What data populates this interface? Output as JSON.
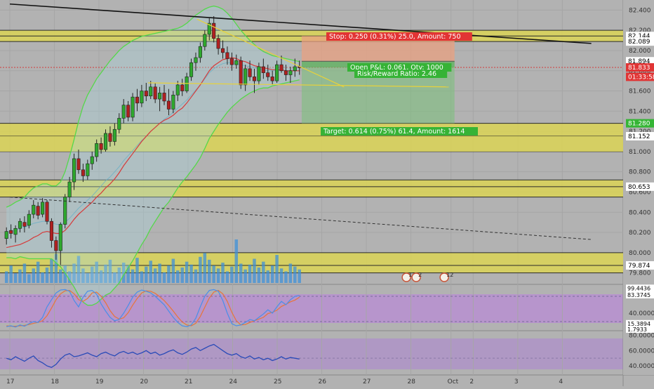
{
  "colors": {
    "background": "#b2b2b2",
    "zone_fill": "#d8d25a",
    "zone_line": "#2a2a2a",
    "stop_fill": "#e8a080",
    "target_fill": "#7ec07e",
    "up_candle": "#2ea82e",
    "down_candle": "#b02020",
    "bollinger": "#55d84a",
    "ema": "#d63a3a",
    "stoch_k": "#4a8ee8",
    "stoch_d": "#e8743a",
    "rsi": "#2a4bb8",
    "volume": "#3d90d8",
    "stoch_panel": "#b78fd0",
    "rsi_panel": "#ad8fca"
  },
  "price_axis": {
    "ticks": [
      "82.400",
      "82.200",
      "82.000",
      "81.800",
      "81.600",
      "81.400",
      "81.200",
      "81.000",
      "80.800",
      "80.600",
      "80.400",
      "80.200",
      "80.000",
      "79.800"
    ],
    "badges": [
      {
        "label": "82.144",
        "price": 82.144,
        "bg": "#ffffff",
        "fg": "#000000"
      },
      {
        "label": "82.089",
        "price": 82.089,
        "bg": "#ffffff",
        "fg": "#000000"
      },
      {
        "label": "81.894",
        "price": 81.894,
        "bg": "#ffffff",
        "fg": "#000000"
      },
      {
        "label": "81.833",
        "price": 81.833,
        "bg": "#e03535",
        "fg": "#ffffff"
      },
      {
        "label": "01:33:58",
        "price": 81.74,
        "bg": "#e03535",
        "fg": "#ffffff"
      },
      {
        "label": "81.280",
        "price": 81.28,
        "bg": "#35b535",
        "fg": "#ffffff"
      },
      {
        "label": "81.152",
        "price": 81.152,
        "bg": "#ffffff",
        "fg": "#000000"
      },
      {
        "label": "80.653",
        "price": 80.653,
        "bg": "#ffffff",
        "fg": "#000000"
      },
      {
        "label": "79.874",
        "price": 79.874,
        "bg": "#ffffff",
        "fg": "#000000"
      }
    ]
  },
  "stoch_axis": {
    "ticks": [
      "40.0000"
    ],
    "badges": [
      {
        "label": "99.4436",
        "value": 99.44,
        "bg": "#ffffff",
        "fg": "#000000"
      },
      {
        "label": "83.3745",
        "value": 83.37,
        "bg": "#ffffff",
        "fg": "#000000"
      },
      {
        "label": "15.3894",
        "value": 15.39,
        "bg": "#ffffff",
        "fg": "#000000"
      },
      {
        "label": "1.7933",
        "value": 1.79,
        "bg": "#ffffff",
        "fg": "#000000"
      }
    ]
  },
  "rsi_axis": {
    "ticks": [
      "80.0000",
      "60.0000",
      "40.0000"
    ]
  },
  "time_axis": {
    "labels": [
      {
        "label": "17",
        "t": 0
      },
      {
        "label": "18",
        "t": 1
      },
      {
        "label": "19",
        "t": 2
      },
      {
        "label": "20",
        "t": 3
      },
      {
        "label": "21",
        "t": 4
      },
      {
        "label": "24",
        "t": 5
      },
      {
        "label": "25",
        "t": 6
      },
      {
        "label": "26",
        "t": 7
      },
      {
        "label": "27",
        "t": 8
      },
      {
        "label": "28",
        "t": 9
      },
      {
        "label": "Oct",
        "t": 9.9
      },
      {
        "label": "2",
        "t": 10.4
      },
      {
        "label": "3",
        "t": 11.4
      },
      {
        "label": "4",
        "t": 12.4
      }
    ]
  },
  "annotations": {
    "stop": "Stop: 0.250 (0.31%) 25.0, Amount: 750",
    "open_pl": "Open P&L: 0.061, Qty: 1000",
    "risk_reward": "Risk/Reward Ratio: 2.46",
    "target": "Target: 0.614 (0.75%) 61.4, Amount: 1614"
  },
  "events": [
    {
      "label": "123",
      "t": 8.9
    },
    {
      "label": "2",
      "t": 9.12
    },
    {
      "label": "12",
      "t": 9.75
    }
  ],
  "chart_data": {
    "type": "candlestick",
    "instrument_hint": "price (value axis 79.80–82.40)",
    "ylim": [
      79.7,
      82.5
    ],
    "x_unit": "trading day index (17=0, 18=1, 19=2, 20=3, 21=4, 24=5, 25=6)",
    "zones": [
      {
        "low": 82.089,
        "high": 82.144,
        "upper_edge": 82.2
      },
      {
        "low": 81.28,
        "high": 81.152,
        "extra_line": 81.0
      },
      {
        "low": 80.653,
        "high": 80.55,
        "upper_edge": 80.72
      },
      {
        "low": 79.874,
        "high": 79.8,
        "upper_edge": 80.0
      }
    ],
    "position": {
      "type": "long",
      "start_t": 6.55,
      "end_t": 9.98,
      "entry": 81.894,
      "stop": 82.144,
      "target": 81.28,
      "current": 81.833
    },
    "trendlines": [
      {
        "style": "solid",
        "t1": 0,
        "p1": 82.46,
        "t2": 13.05,
        "p2": 82.07
      },
      {
        "style": "dashed",
        "t1": 0,
        "p1": 80.55,
        "t2": 13.05,
        "p2": 80.13
      },
      {
        "style": "solid-yellow",
        "t1": 4.2,
        "p1": 82.31,
        "t2": 7.5,
        "p2": 81.64
      },
      {
        "style": "flat-yellow",
        "t1": 3.1,
        "p1": 81.68,
        "t2": 9.85,
        "p2": 81.64
      }
    ],
    "candles_ohlc": [
      [
        80.14,
        80.25,
        80.08,
        80.21
      ],
      [
        80.22,
        80.28,
        80.14,
        80.19
      ],
      [
        80.18,
        80.27,
        80.1,
        80.24
      ],
      [
        80.24,
        80.34,
        80.2,
        80.31
      ],
      [
        80.3,
        80.36,
        80.2,
        80.26
      ],
      [
        80.27,
        80.42,
        80.24,
        80.38
      ],
      [
        80.38,
        80.52,
        80.34,
        80.47
      ],
      [
        80.46,
        80.5,
        80.33,
        80.37
      ],
      [
        80.38,
        80.54,
        80.35,
        80.5
      ],
      [
        80.5,
        80.52,
        80.28,
        80.31
      ],
      [
        80.31,
        80.34,
        80.05,
        80.12
      ],
      [
        80.12,
        80.16,
        79.93,
        80.02
      ],
      [
        80.02,
        80.3,
        79.88,
        80.28
      ],
      [
        80.28,
        80.58,
        80.24,
        80.55
      ],
      [
        80.55,
        80.75,
        80.5,
        80.7
      ],
      [
        80.7,
        80.98,
        80.62,
        80.93
      ],
      [
        80.93,
        81.02,
        80.78,
        80.82
      ],
      [
        80.82,
        80.88,
        80.7,
        80.76
      ],
      [
        80.76,
        80.92,
        80.72,
        80.88
      ],
      [
        80.88,
        81.0,
        80.82,
        80.95
      ],
      [
        80.95,
        81.12,
        80.9,
        81.08
      ],
      [
        81.08,
        81.14,
        80.98,
        81.02
      ],
      [
        81.02,
        81.22,
        81.0,
        81.18
      ],
      [
        81.18,
        81.25,
        81.05,
        81.1
      ],
      [
        81.1,
        81.28,
        81.06,
        81.22
      ],
      [
        81.22,
        81.38,
        81.18,
        81.33
      ],
      [
        81.33,
        81.52,
        81.28,
        81.46
      ],
      [
        81.46,
        81.5,
        81.3,
        81.34
      ],
      [
        81.34,
        81.58,
        81.3,
        81.54
      ],
      [
        81.54,
        81.62,
        81.4,
        81.48
      ],
      [
        81.48,
        81.66,
        81.44,
        81.6
      ],
      [
        81.6,
        81.68,
        81.5,
        81.55
      ],
      [
        81.55,
        81.7,
        81.52,
        81.64
      ],
      [
        81.64,
        81.68,
        81.48,
        81.52
      ],
      [
        81.52,
        81.64,
        81.4,
        81.58
      ],
      [
        81.58,
        81.66,
        81.46,
        81.5
      ],
      [
        81.5,
        81.62,
        81.36,
        81.42
      ],
      [
        81.42,
        81.6,
        81.38,
        81.56
      ],
      [
        81.56,
        81.7,
        81.5,
        81.66
      ],
      [
        81.66,
        81.72,
        81.55,
        81.6
      ],
      [
        81.6,
        81.78,
        81.58,
        81.74
      ],
      [
        81.74,
        81.92,
        81.7,
        81.88
      ],
      [
        81.88,
        81.98,
        81.8,
        81.93
      ],
      [
        81.93,
        82.08,
        81.88,
        82.04
      ],
      [
        82.04,
        82.2,
        82.0,
        82.16
      ],
      [
        82.16,
        82.32,
        82.1,
        82.27
      ],
      [
        82.27,
        82.34,
        82.08,
        82.12
      ],
      [
        82.12,
        82.16,
        81.96,
        82.02
      ],
      [
        82.02,
        82.1,
        81.92,
        81.98
      ],
      [
        81.98,
        82.04,
        81.86,
        81.92
      ],
      [
        81.92,
        81.98,
        81.8,
        81.86
      ],
      [
        81.86,
        81.96,
        81.82,
        81.9
      ],
      [
        81.9,
        81.94,
        81.62,
        81.66
      ],
      [
        81.66,
        81.86,
        81.6,
        81.82
      ],
      [
        81.82,
        81.9,
        81.7,
        81.74
      ],
      [
        81.74,
        81.82,
        81.58,
        81.7
      ],
      [
        81.7,
        81.88,
        81.66,
        81.84
      ],
      [
        81.84,
        81.92,
        81.72,
        81.78
      ],
      [
        81.78,
        81.86,
        81.7,
        81.74
      ],
      [
        81.74,
        81.8,
        81.66,
        81.7
      ],
      [
        81.7,
        81.9,
        81.68,
        81.86
      ],
      [
        81.86,
        81.95,
        81.78,
        81.8
      ],
      [
        81.8,
        81.86,
        81.7,
        81.76
      ],
      [
        81.76,
        81.84,
        81.68,
        81.8
      ],
      [
        81.8,
        81.92,
        81.74,
        81.84
      ],
      [
        81.84,
        81.9,
        81.76,
        81.83
      ]
    ],
    "bollinger": {
      "upper": [
        80.45,
        80.47,
        80.5,
        80.52,
        80.55,
        80.6,
        80.64,
        80.66,
        80.68,
        80.68,
        80.66,
        80.66,
        80.7,
        80.8,
        80.95,
        81.12,
        81.3,
        81.45,
        81.56,
        81.64,
        81.72,
        81.78,
        81.84,
        81.9,
        81.95,
        82.0,
        82.04,
        82.07,
        82.1,
        82.12,
        82.14,
        82.15,
        82.16,
        82.17,
        82.18,
        82.19,
        82.2,
        82.21,
        82.22,
        82.24,
        82.27,
        82.31,
        82.35,
        82.38,
        82.41,
        82.43,
        82.44,
        82.43,
        82.41,
        82.37,
        82.32,
        82.26,
        82.2,
        82.15,
        82.1,
        82.06,
        82.02,
        81.99,
        81.97,
        81.95,
        81.94,
        81.93,
        81.92,
        81.91,
        81.9,
        81.89
      ],
      "middle": [
        80.2,
        80.21,
        80.22,
        80.24,
        80.25,
        80.27,
        80.29,
        80.3,
        80.31,
        80.31,
        80.3,
        80.28,
        80.28,
        80.3,
        80.34,
        80.39,
        80.44,
        80.48,
        80.52,
        80.56,
        80.61,
        80.66,
        80.71,
        80.75,
        80.8,
        80.85,
        80.91,
        80.96,
        81.01,
        81.06,
        81.11,
        81.15,
        81.2,
        81.24,
        81.28,
        81.32,
        81.35,
        81.39,
        81.43,
        81.47,
        81.51,
        81.56,
        81.61,
        81.66,
        81.72,
        81.78,
        81.82,
        81.85,
        81.87,
        81.88,
        81.88,
        81.87,
        81.86,
        81.85,
        81.84,
        81.83,
        81.82,
        81.81,
        81.8,
        81.8,
        81.8,
        81.8,
        81.8,
        81.8,
        81.8,
        81.8
      ],
      "lower": [
        79.95,
        79.95,
        79.94,
        79.96,
        79.95,
        79.94,
        79.94,
        79.94,
        79.94,
        79.94,
        79.94,
        79.9,
        79.86,
        79.8,
        79.73,
        79.66,
        79.58,
        79.51,
        79.48,
        79.48,
        79.5,
        79.54,
        79.58,
        79.6,
        79.65,
        79.7,
        79.78,
        79.85,
        79.92,
        80.0,
        80.08,
        80.15,
        80.24,
        80.31,
        80.38,
        80.45,
        80.5,
        80.57,
        80.64,
        80.7,
        80.75,
        80.81,
        80.87,
        80.94,
        81.03,
        81.13,
        81.2,
        81.27,
        81.33,
        81.39,
        81.44,
        81.48,
        81.52,
        81.55,
        81.58,
        81.6,
        81.62,
        81.63,
        81.63,
        81.65,
        81.66,
        81.67,
        81.68,
        81.69,
        81.7,
        81.71
      ]
    },
    "ema": [
      80.05,
      80.06,
      80.07,
      80.08,
      80.1,
      80.12,
      80.15,
      80.17,
      80.2,
      80.21,
      80.2,
      80.19,
      80.19,
      80.22,
      80.27,
      80.33,
      80.38,
      80.42,
      80.46,
      80.5,
      80.55,
      80.59,
      80.64,
      80.68,
      80.73,
      80.79,
      80.86,
      80.92,
      80.98,
      81.04,
      81.1,
      81.15,
      81.2,
      81.24,
      81.28,
      81.31,
      81.33,
      81.36,
      81.4,
      81.43,
      81.48,
      81.54,
      81.6,
      81.66,
      81.73,
      81.8,
      81.85,
      81.88,
      81.91,
      81.92,
      81.93,
      81.92,
      81.9,
      81.89,
      81.87,
      81.85,
      81.84,
      81.83,
      81.82,
      81.81,
      81.81,
      81.81,
      81.8,
      81.8,
      81.8,
      81.8
    ],
    "volume": [
      12,
      18,
      10,
      14,
      20,
      9,
      15,
      22,
      11,
      16,
      25,
      30,
      14,
      18,
      12,
      20,
      28,
      15,
      10,
      17,
      22,
      13,
      19,
      24,
      11,
      16,
      21,
      18,
      14,
      26,
      12,
      17,
      23,
      15,
      20,
      11,
      18,
      25,
      13,
      16,
      22,
      19,
      14,
      27,
      31,
      24,
      18,
      15,
      21,
      12,
      17,
      45,
      20,
      14,
      19,
      25,
      16,
      22,
      13,
      18,
      29,
      15,
      12,
      20,
      17,
      14
    ],
    "stochastic": {
      "k": [
        8,
        10,
        7,
        12,
        9,
        15,
        20,
        18,
        30,
        55,
        72,
        88,
        95,
        96,
        92,
        70,
        55,
        78,
        92,
        94,
        85,
        62,
        45,
        30,
        22,
        25,
        40,
        58,
        78,
        90,
        95,
        92,
        88,
        80,
        70,
        60,
        45,
        30,
        18,
        10,
        8,
        12,
        28,
        55,
        80,
        94,
        96,
        92,
        70,
        40,
        15,
        10,
        12,
        18,
        25,
        22,
        30,
        38,
        48,
        40,
        55,
        68,
        60,
        72,
        80,
        82
      ],
      "d": [
        10,
        9,
        9,
        10,
        11,
        13,
        16,
        18,
        22,
        34,
        52,
        72,
        86,
        93,
        94,
        86,
        72,
        68,
        75,
        88,
        90,
        80,
        65,
        46,
        32,
        26,
        29,
        41,
        59,
        75,
        88,
        93,
        92,
        87,
        79,
        70,
        58,
        45,
        31,
        19,
        12,
        10,
        16,
        32,
        54,
        76,
        90,
        94,
        86,
        68,
        42,
        22,
        12,
        13,
        18,
        22,
        26,
        30,
        39,
        42,
        47,
        56,
        61,
        67,
        71,
        78
      ],
      "bands": [
        80,
        20
      ]
    },
    "rsi": [
      50,
      48,
      52,
      49,
      46,
      50,
      53,
      47,
      44,
      40,
      38,
      42,
      49,
      54,
      56,
      52,
      53,
      55,
      57,
      54,
      52,
      56,
      58,
      55,
      53,
      57,
      59,
      56,
      58,
      55,
      57,
      60,
      56,
      58,
      54,
      56,
      59,
      61,
      57,
      55,
      58,
      62,
      64,
      60,
      63,
      66,
      68,
      64,
      60,
      56,
      54,
      56,
      52,
      50,
      53,
      49,
      51,
      48,
      50,
      47,
      49,
      52,
      49,
      51,
      50,
      49
    ],
    "stoch_ylim": [
      0,
      105
    ],
    "rsi_ylim": [
      30,
      85
    ]
  }
}
